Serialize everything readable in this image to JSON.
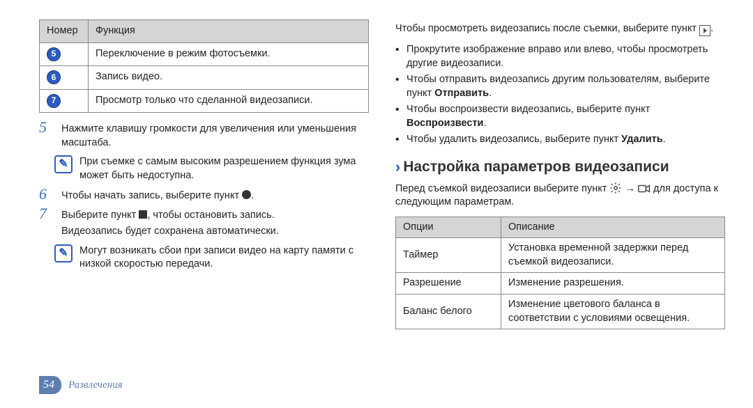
{
  "left": {
    "table": {
      "headers": {
        "num": "Номер",
        "func": "Функция"
      },
      "rows": [
        {
          "num": "5",
          "func": "Переключение в режим фотосъемки."
        },
        {
          "num": "6",
          "func": "Запись видео."
        },
        {
          "num": "7",
          "func": "Просмотр только что сделанной видеозаписи."
        }
      ]
    },
    "step5": {
      "num": "5",
      "text": "Нажмите клавишу громкости для увеличения или уменьшения масштаба."
    },
    "note1": "При съемке с самым высоким разрешением функция зума может быть недоступна.",
    "step6": {
      "num": "6",
      "pre": "Чтобы начать запись, выберите пункт ",
      "post": "."
    },
    "step7": {
      "num": "7",
      "pre": "Выберите пункт ",
      "mid": ", чтобы остановить запись.",
      "line2": "Видеозапись будет сохранена автоматически."
    },
    "note2": "Могут возникать сбои при записи видео на карту памяти с низкой скоростью передачи."
  },
  "right": {
    "intro_pre": "Чтобы просмотреть видеозапись после съемки, выберите пункт ",
    "intro_post": ".",
    "bullets": [
      {
        "text": "Прокрутите изображение вправо или влево, чтобы просмотреть другие видеозаписи."
      },
      {
        "pre": "Чтобы отправить видеозапись другим пользователям, выберите пункт ",
        "bold": "Отправить",
        "post": "."
      },
      {
        "pre": "Чтобы воспроизвести видеозапись, выберите пункт ",
        "bold": "Воспроизвести",
        "post": "."
      },
      {
        "pre": "Чтобы удалить видеозапись, выберите пункт ",
        "bold": "Удалить",
        "post": "."
      }
    ],
    "section_arrow": "›",
    "section_title": "Настройка параметров видеозаписи",
    "section_para_pre": "Перед съемкой видеозаписи выберите пункт ",
    "section_para_arrow": " → ",
    "section_para_post": " для доступа к следующим параметрам.",
    "opts_table": {
      "headers": {
        "opt": "Опции",
        "desc": "Описание"
      },
      "rows": [
        {
          "opt": "Таймер",
          "desc": "Установка временной задержки перед съемкой видеозаписи."
        },
        {
          "opt": "Разрешение",
          "desc": "Изменение разрешения."
        },
        {
          "opt": "Баланс белого",
          "desc": "Изменение цветового баланса в соответствии с условиями освещения."
        }
      ]
    }
  },
  "footer": {
    "page": "54",
    "section": "Развлечения"
  }
}
